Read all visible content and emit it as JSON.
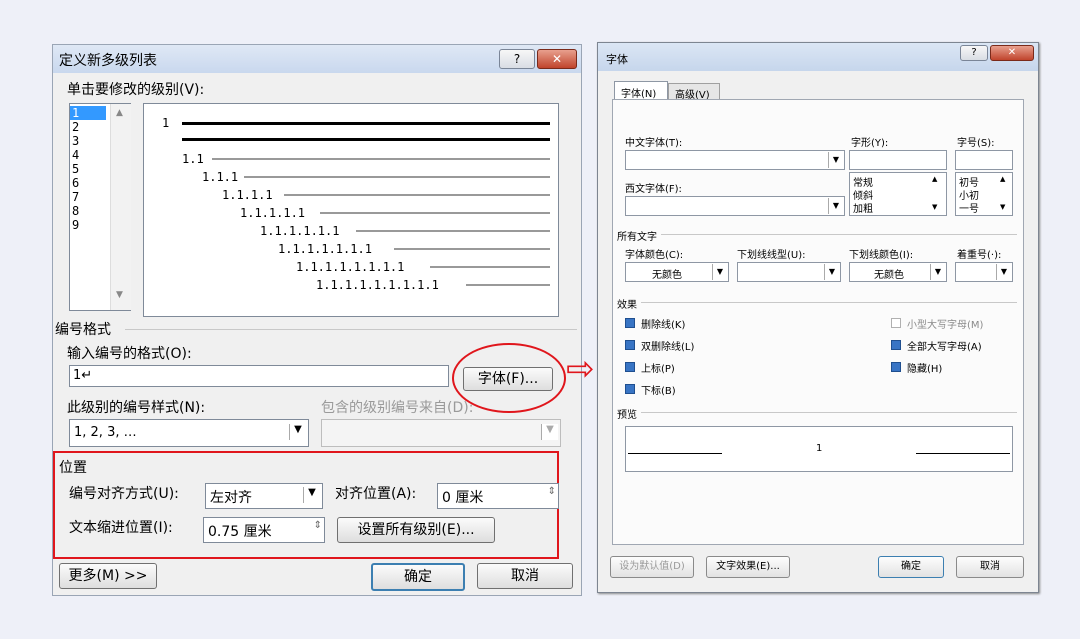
{
  "left": {
    "title": "定义新多级列表",
    "help_btn": "?",
    "close_btn": "✕",
    "level_label": "单击要修改的级别(V):",
    "levels": [
      "1",
      "2",
      "3",
      "4",
      "5",
      "6",
      "7",
      "8",
      "9"
    ],
    "preview_lines": [
      "1",
      "1.1",
      "1.1.1",
      "1.1.1.1",
      "1.1.1.1.1",
      "1.1.1.1.1.1",
      "1.1.1.1.1.1.1",
      "1.1.1.1.1.1.1.1",
      "1.1.1.1.1.1.1.1.1"
    ],
    "number_format_group": "编号格式",
    "enter_format_label": "输入编号的格式(O):",
    "format_value": "1↵",
    "font_button": "字体(F)...",
    "style_label": "此级别的编号样式(N):",
    "style_value": "1, 2, 3, …",
    "include_label": "包含的级别编号来自(D):",
    "position_group": "位置",
    "align_label": "编号对齐方式(U):",
    "align_value": "左对齐",
    "align_at_label": "对齐位置(A):",
    "align_at_value": "0 厘米",
    "indent_label": "文本缩进位置(I):",
    "indent_value": "0.75 厘米",
    "set_all_button": "设置所有级别(E)...",
    "more_button": "更多(M) >>",
    "ok_button": "确定",
    "cancel_button": "取消"
  },
  "arrow": "⇨",
  "right": {
    "title": "字体",
    "help_btn": "?",
    "close_btn": "✕",
    "tab_font": "字体(N)",
    "tab_advanced": "高级(V)",
    "cn_font_label": "中文字体(T):",
    "style_label": "字形(Y):",
    "size_label": "字号(S):",
    "west_font_label": "西文字体(F):",
    "styles": [
      "常规",
      "倾斜",
      "加粗"
    ],
    "sizes": [
      "初号",
      "小初",
      "一号"
    ],
    "all_text_group": "所有文字",
    "color_label": "字体颜色(C):",
    "color_value": "无颜色",
    "underline_label": "下划线线型(U):",
    "underline_color_label": "下划线颜色(I):",
    "underline_color_value": "无颜色",
    "emphasis_label": "着重号(·):",
    "effects_group": "效果",
    "effects": [
      {
        "label": "删除线(K)"
      },
      {
        "label": "双删除线(L)"
      },
      {
        "label": "上标(P)"
      },
      {
        "label": "下标(B)"
      }
    ],
    "effects_right": [
      {
        "label": "小型大写字母(M)"
      },
      {
        "label": "全部大写字母(A)"
      },
      {
        "label": "隐藏(H)"
      }
    ],
    "preview_group": "预览",
    "preview_text": "1",
    "default_button": "设为默认值(D)",
    "text_effects_button": "文字效果(E)...",
    "ok_button": "确定",
    "cancel_button": "取消"
  },
  "colors": {
    "highlight_red": "#e0161c",
    "checkbox_blue": "#3874c4"
  }
}
